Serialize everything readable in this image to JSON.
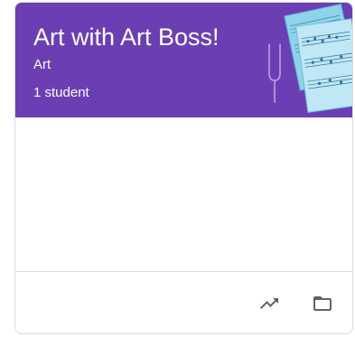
{
  "class_card": {
    "title": "Art with Art Boss!",
    "section": "Art",
    "students": "1 student",
    "header_color": "#6b3fb3"
  },
  "footer": {
    "icons": [
      "trending-up-icon",
      "folder-icon"
    ]
  }
}
